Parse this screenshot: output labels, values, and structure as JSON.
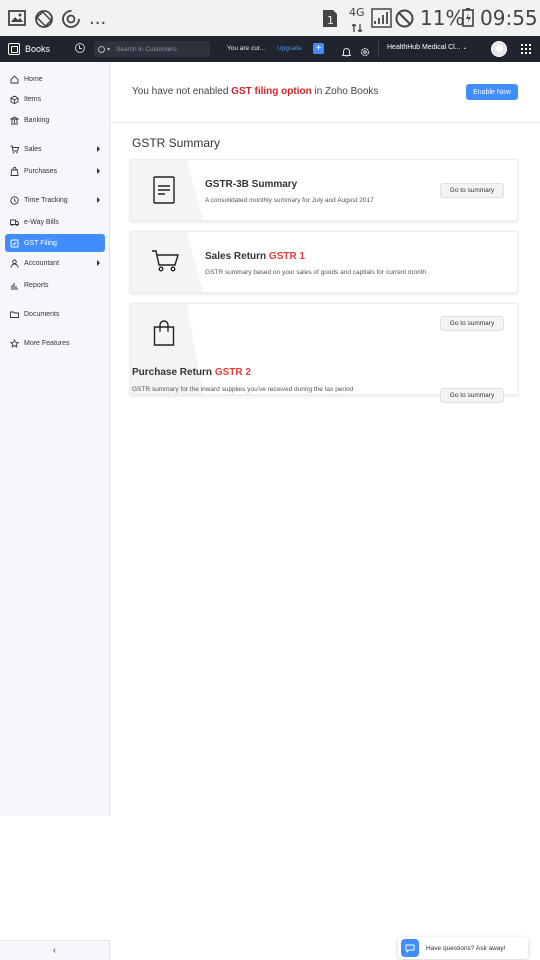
{
  "status_bar": {
    "battery": "11%",
    "time": "09:55",
    "network": "4G",
    "sim_slot": "1",
    "more": "..."
  },
  "topnav": {
    "app_name": "Books",
    "search_placeholder": "Search in Customers",
    "trial_text": "You are cur...",
    "upgrade_label": "Upgrade",
    "org_name": "HealthHub Medical Cl..."
  },
  "sidebar": {
    "items": [
      {
        "label": "Home",
        "icon": "home-icon"
      },
      {
        "label": "Items",
        "icon": "items-icon"
      },
      {
        "label": "Banking",
        "icon": "bank-icon"
      },
      {
        "label": "Sales",
        "icon": "cart-icon"
      },
      {
        "label": "Purchases",
        "icon": "bag-icon"
      },
      {
        "label": "Time Tracking",
        "icon": "clock-icon"
      },
      {
        "label": "e-Way Bills",
        "icon": "truck-icon"
      },
      {
        "label": "GST Filing",
        "icon": "gst-icon"
      },
      {
        "label": "Accountant",
        "icon": "person-icon"
      },
      {
        "label": "Reports",
        "icon": "chart-icon"
      },
      {
        "label": "Documents",
        "icon": "folder-icon"
      },
      {
        "label": "More Features",
        "icon": "star-icon"
      }
    ],
    "active": "GST Filing"
  },
  "banner": {
    "text_pre": "You have not enabled ",
    "text_highlight": "GST filing option",
    "text_post": " in Zoho Books",
    "button_label": "Enable Now"
  },
  "main": {
    "section_title": "GSTR Summary",
    "cards": [
      {
        "title": "GSTR-3B Summary",
        "title_suffix": "",
        "description": "A consolidated monthly summary for July and August 2017",
        "button_label": "Go to summary",
        "icon": "document-icon"
      },
      {
        "title": "Sales Return ",
        "title_suffix": "GSTR 1",
        "description": "GSTR summary based on your sales of goods and captials for current month",
        "button_label": "",
        "icon": "cart-icon"
      },
      {
        "title": "Purchase Return ",
        "title_suffix": "GSTR 2",
        "description": "GSTR summary for the inward supplies you've received during the tax period",
        "button_label": "Go to summary",
        "button_label_top": "Go to summary",
        "icon": "shopping-bag-icon"
      }
    ]
  },
  "chat": {
    "label": "Have questions? Ask away!"
  },
  "colors": {
    "accent": "#408dfb",
    "highlight_red": "#d4242a",
    "nav_bg": "#20242d"
  }
}
